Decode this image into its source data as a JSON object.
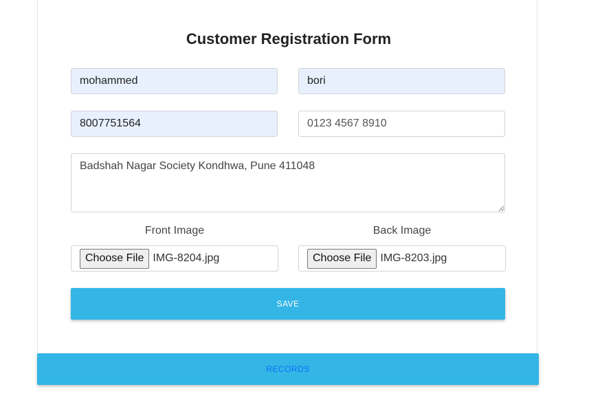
{
  "form": {
    "title": "Customer Registration Form",
    "first_name": {
      "value": "mohammed"
    },
    "last_name": {
      "value": "bori"
    },
    "mobile": {
      "value": "8007751564"
    },
    "alt_phone": {
      "value": "",
      "placeholder": "0123 4567 8910"
    },
    "address": {
      "value": "",
      "placeholder": "Badshah Nagar Society Kondhwa, Pune 411048"
    },
    "front_image": {
      "label": "Front Image",
      "button_label": "Choose File",
      "file_name": "IMG-8204.jpg"
    },
    "back_image": {
      "label": "Back Image",
      "button_label": "Choose File",
      "file_name": "IMG-8203.jpg"
    },
    "save_label": "SAVE"
  },
  "records_label": "RECORDS",
  "colors": {
    "accent": "#33b5e5",
    "autofill_bg": "#e8f0fe",
    "link": "#0d6efd"
  }
}
